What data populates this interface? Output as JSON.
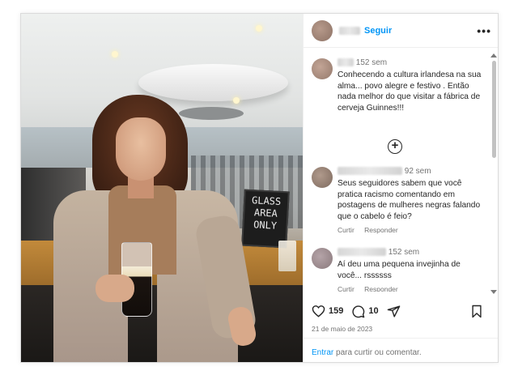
{
  "post": {
    "header": {
      "follow_label": "Seguir",
      "more_label": "•••"
    },
    "photo": {
      "sign_text": [
        "GLASS",
        "AREA",
        "ONLY"
      ]
    },
    "comments": [
      {
        "time": "152 sem",
        "text": "Conhecendo a cultura irlandesa na sua alma... povo alegre e festivo . Então nada melhor do que visitar a fábrica de cerveja Guinnes!!!",
        "avatar_color": "#b79a8b"
      },
      {
        "time": "92 sem",
        "text": "Seus seguidores sabem que você pratica racismo comentando em postagens de mulheres negras falando que o cabelo é feio?",
        "reply_label": "Responder",
        "like_label": "Curtir",
        "avatar_color": "#8f7a6d"
      },
      {
        "time": "152 sem",
        "text": "Aí deu uma pequena invejinha de você... rssssss",
        "reply_label": "Responder",
        "like_label": "Curtir",
        "avatar_color": "#a08f93"
      }
    ],
    "expand_label": "+",
    "likes": "159",
    "comments_count": "10",
    "date": "21 de maio de 2023",
    "footer": {
      "login_link": "Entrar",
      "rest": " para curtir ou comentar."
    }
  }
}
